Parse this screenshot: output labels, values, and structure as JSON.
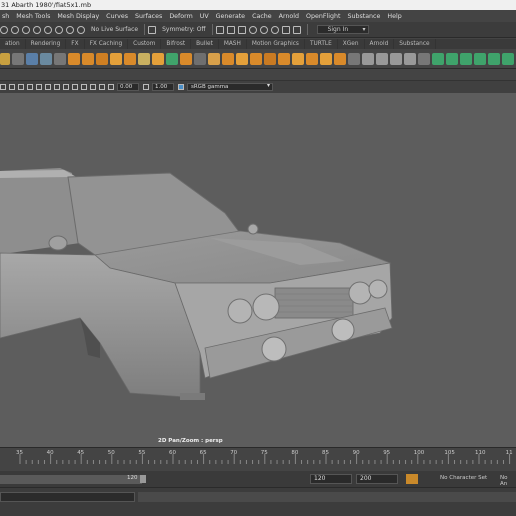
{
  "window": {
    "title": "31 Abarth 1980'/fiat5x1.mb"
  },
  "menu": [
    "sh",
    "Mesh Tools",
    "Mesh Display",
    "Curves",
    "Surfaces",
    "Deform",
    "UV",
    "Generate",
    "Cache",
    "Arnold",
    "OpenFlight",
    "Substance",
    "Help"
  ],
  "status_line": {
    "live_surface": "No Live Surface",
    "symmetry": "Symmetry: Off",
    "sign_in": "Sign In"
  },
  "shelf_tabs": [
    "ation",
    "Rendering",
    "FX",
    "FX Caching",
    "Custom",
    "Bifrost",
    "Bullet",
    "MASH",
    "Motion Graphics",
    "TURTLE",
    "XGen",
    "Arnold",
    "Substance"
  ],
  "panel_toolbar": {
    "exposure": "0.00",
    "gamma": "1.00",
    "color_space": "sRGB gamma"
  },
  "viewport": {
    "camera_label": "2D Pan/Zoom : persp"
  },
  "timeline": {
    "ticks": [
      "35",
      "40",
      "45",
      "50",
      "55",
      "60",
      "65",
      "70",
      "75",
      "80",
      "85",
      "90",
      "95",
      "100",
      "105",
      "110",
      "11"
    ]
  },
  "range": {
    "end_frame": "120",
    "anim_end": "120",
    "max_end": "200",
    "character_set": "No Character Set",
    "anim_layer": "No An"
  },
  "colors": {
    "viewport_bg": "#5d5d5d",
    "shelf_green": "#3fa36b",
    "shelf_orange": "#e49a2c",
    "shelf_blue": "#4a8fc8"
  }
}
